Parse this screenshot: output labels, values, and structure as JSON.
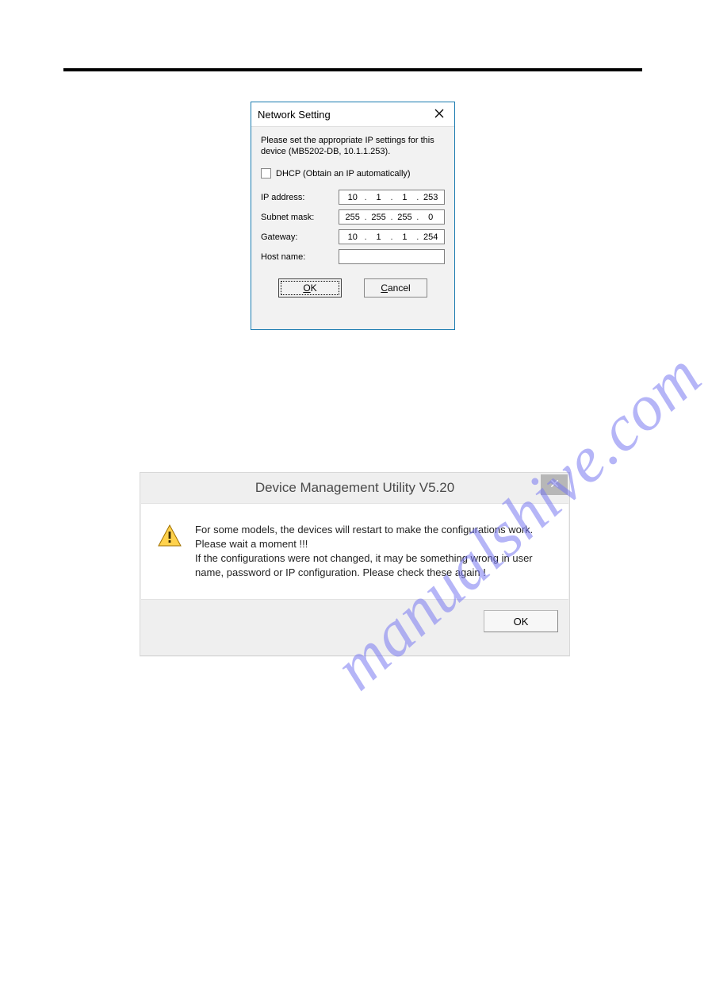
{
  "watermark": "manualshive.com",
  "dialog1": {
    "title": "Network Setting",
    "instruction": "Please set the appropriate IP settings for this device (MB5202-DB, 10.1.1.253).",
    "dhcp_label": "DHCP (Obtain an IP automatically)",
    "labels": {
      "ip": "IP address:",
      "subnet": "Subnet mask:",
      "gateway": "Gateway:",
      "hostname": "Host name:"
    },
    "ip": {
      "a": "10",
      "b": "1",
      "c": "1",
      "d": "253"
    },
    "subnet": {
      "a": "255",
      "b": "255",
      "c": "255",
      "d": "0"
    },
    "gateway": {
      "a": "10",
      "b": "1",
      "c": "1",
      "d": "254"
    },
    "hostname": "",
    "ok_label_pre": "O",
    "ok_label_post": "K",
    "cancel_label_pre": "C",
    "cancel_label_post": "ancel"
  },
  "dialog2": {
    "title": "Device Management Utility V5.20",
    "message_line1": "For some models, the devices will restart to make the configurations work. Please wait a moment !!!",
    "message_line2": "If the configurations were not changed, it may be something wrong in user name, password or IP configuration. Please check these again !",
    "ok_label": "OK"
  }
}
